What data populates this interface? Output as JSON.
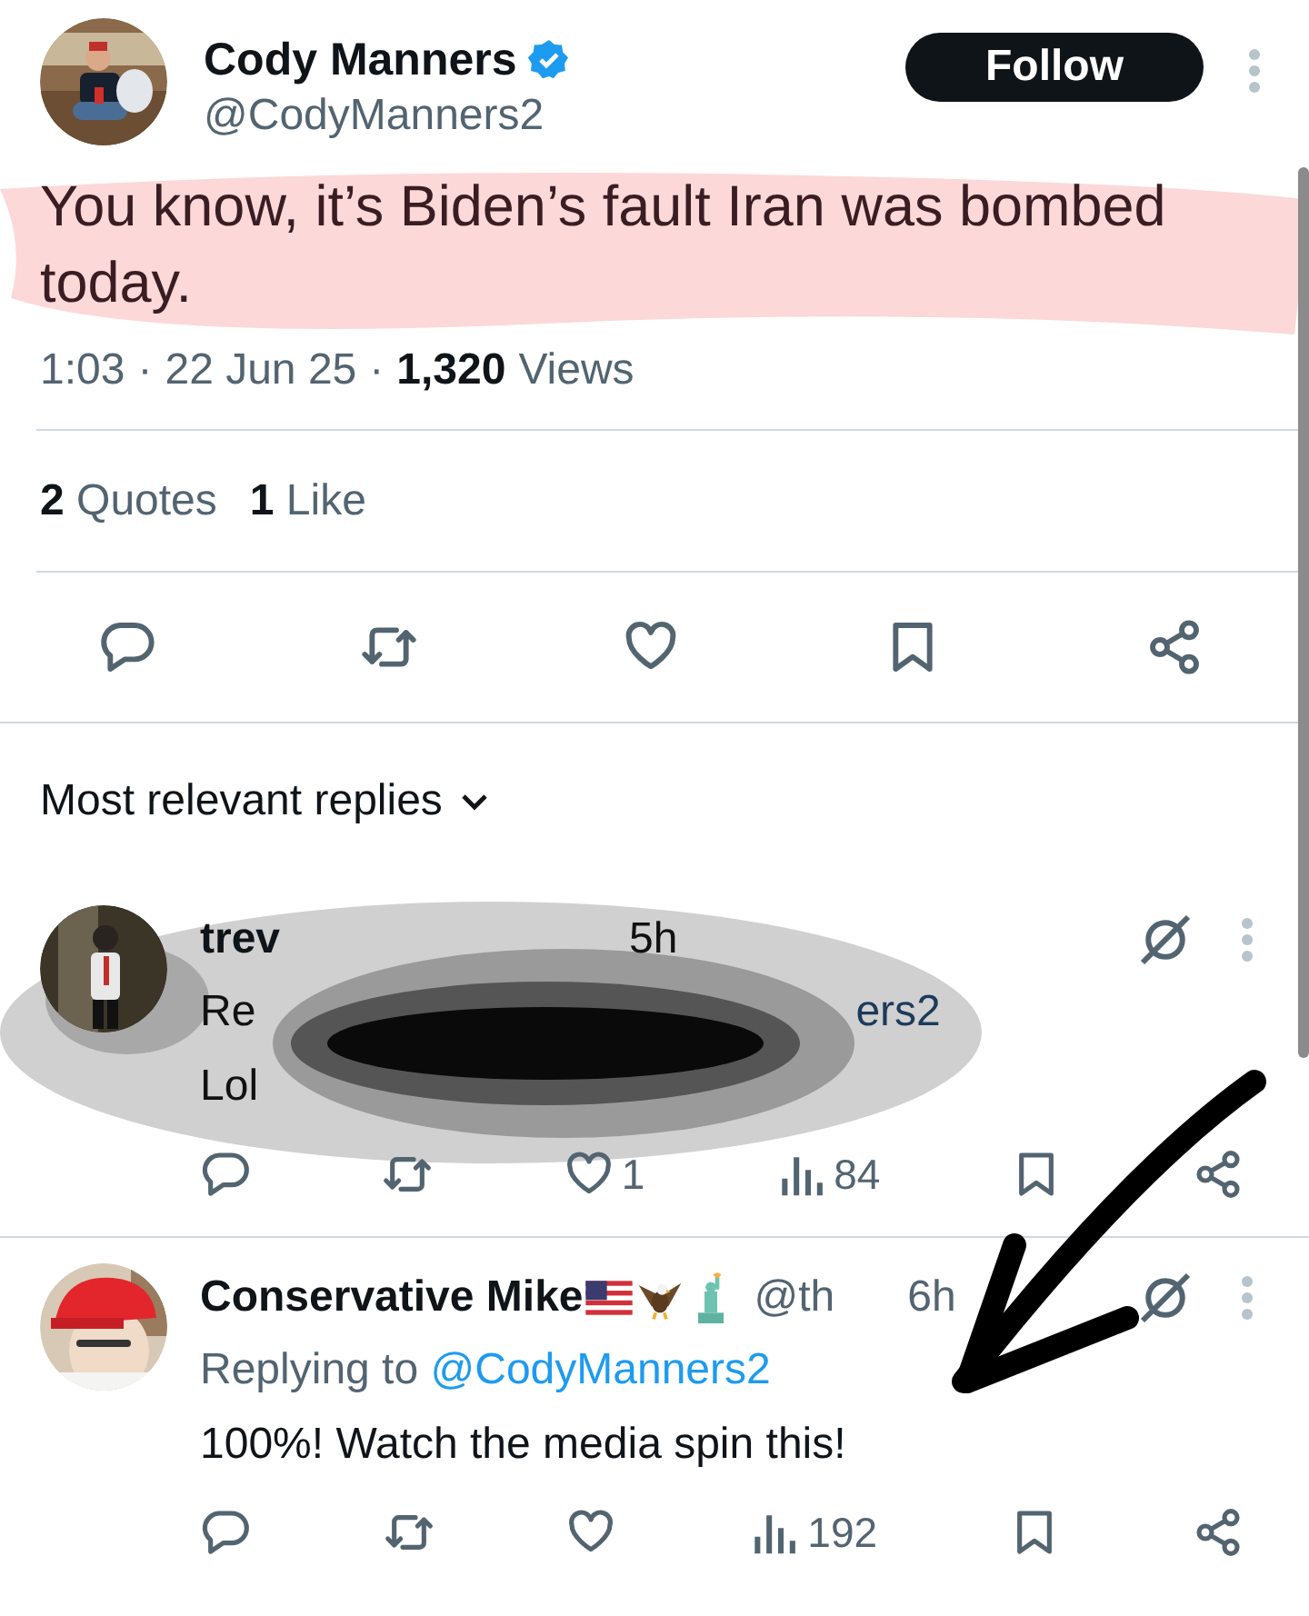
{
  "tweet": {
    "author": {
      "name": "Cody Manners",
      "verified": true,
      "handle": "@CodyManners2"
    },
    "follow_button": "Follow",
    "text": "You know, it’s Biden’s fault Iran was bombed today.",
    "highlighted": true,
    "time": "1:03",
    "separator": "·",
    "date": "22 Jun 25",
    "separator_2": "·",
    "views_count": "1,320",
    "views_label": "Views",
    "stats": [
      {
        "count": "2",
        "label": "Quotes"
      },
      {
        "count": "1",
        "label": "Like"
      }
    ]
  },
  "replies_sort": {
    "label": "Most relevant replies"
  },
  "replies": [
    {
      "name": "trev",
      "time": "5h",
      "replying_start": "Re",
      "replying_end": "ers2",
      "text": "Lol",
      "redacted": true,
      "like_count": "1",
      "views_count": "84"
    },
    {
      "name": "Conservative Mike",
      "emoji_badges": true,
      "handle": "@th",
      "time": "6h",
      "replying_label": "Replying to",
      "replying_to": "@CodyManners2",
      "text": "100%! Watch the media spin this!",
      "redacted": false,
      "views_count": "192"
    }
  ],
  "arrow_annotation": true
}
